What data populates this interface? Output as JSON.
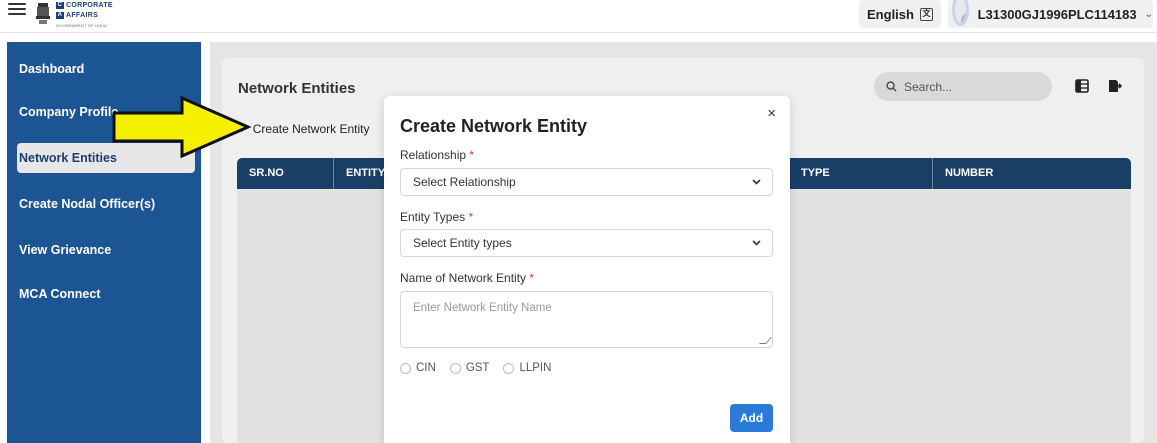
{
  "app": {
    "logo_line1": "CORPORATE",
    "logo_line2": "AFFAIRS",
    "logo_box1": "C",
    "logo_box2": "A",
    "logo_sub": "GOVERNMENT OF INDIA"
  },
  "header": {
    "language_label": "English",
    "language_icon": "translate-icon",
    "user_id": "L31300GJ1996PLC114183",
    "user_caret": "⌄"
  },
  "sidebar": {
    "items": [
      {
        "label": "Dashboard",
        "active": false
      },
      {
        "label": "Company Profile",
        "active": false
      },
      {
        "label": "Network Entities",
        "active": true
      },
      {
        "label": "Create Nodal Officer(s)",
        "active": false
      },
      {
        "label": "View Grievance",
        "active": false
      },
      {
        "label": "MCA Connect",
        "active": false
      }
    ]
  },
  "main": {
    "title": "Network Entities",
    "search_placeholder": "Search...",
    "create_button": "Create Network Entity",
    "table": {
      "columns": [
        "SR.NO",
        "ENTITY",
        "TYPE",
        "NUMBER"
      ]
    }
  },
  "modal": {
    "title": "Create Network Entity",
    "close_glyph": "×",
    "relationship": {
      "label": "Relationship",
      "required_mark": "*",
      "value": "Select Relationship"
    },
    "entity_types": {
      "label": "Entity Types",
      "required_mark": "*",
      "value": "Select Entity types"
    },
    "entity_name": {
      "label": "Name of Network Entity",
      "required_mark": "*",
      "placeholder": "Enter Network Entity Name"
    },
    "id_options": [
      "CIN",
      "GST",
      "LLPIN"
    ],
    "add_button": "Add"
  },
  "colors": {
    "sidebar_bg": "#1c5593",
    "table_header_bg": "#1a3f66",
    "primary_button": "#2a7bd8",
    "arrow_fill": "#f5f000",
    "required": "#e03a3a"
  }
}
